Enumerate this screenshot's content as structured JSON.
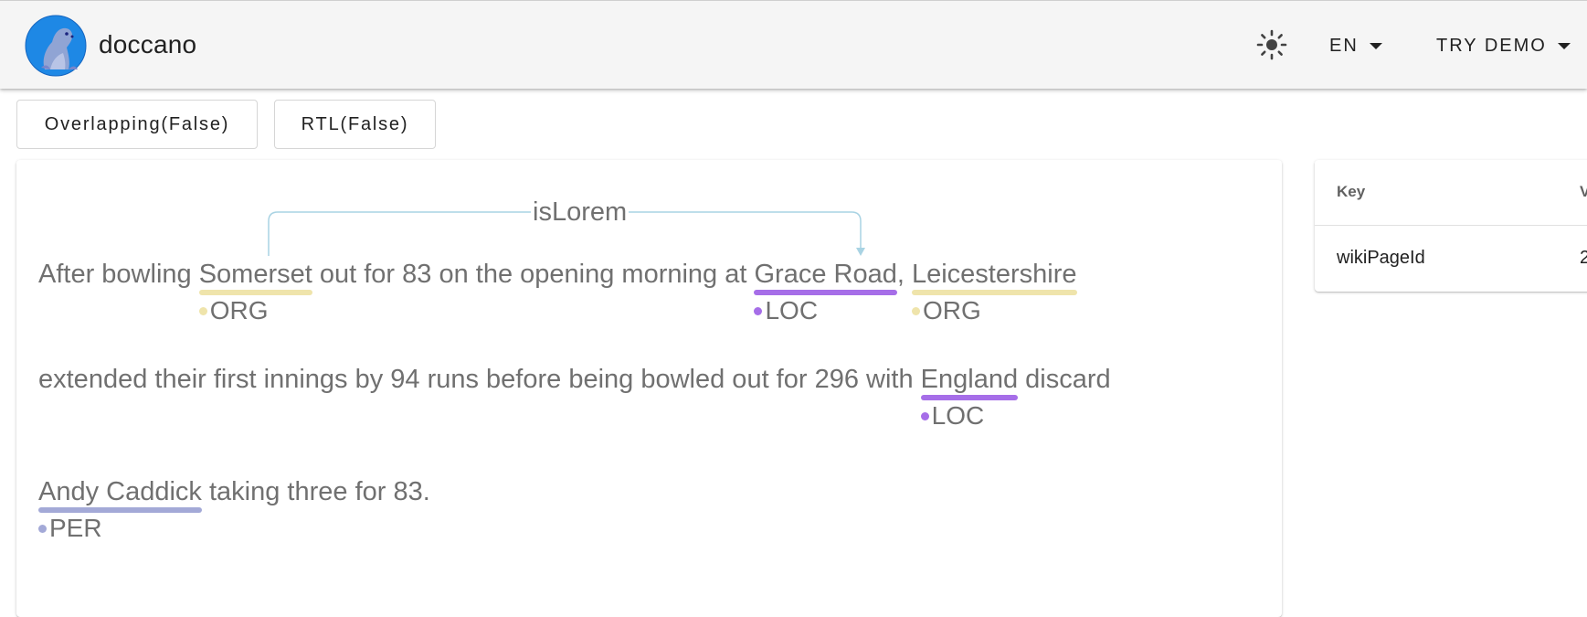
{
  "app": {
    "title": "doccano"
  },
  "header": {
    "theme_icon": "brightness-icon",
    "lang_label": "EN",
    "demo_label": "TRY DEMO"
  },
  "options": {
    "overlapping_label": "Overlapping(False)",
    "rtl_label": "RTL(False)"
  },
  "label_colors": {
    "ORG": "#efe4ab",
    "LOC": "#a66ee8",
    "PER": "#a3a9d7"
  },
  "annotation": {
    "relation": {
      "label": "isLorem",
      "color": "#a9d3e3"
    },
    "line1": {
      "t1": "After bowling ",
      "e1": {
        "text": "Somerset",
        "label": "ORG"
      },
      "t2": " out for 83 on the opening morning at ",
      "e2": {
        "text": "Grace Road",
        "label": "LOC"
      },
      "t3": ", ",
      "e3": {
        "text": "Leicestershire",
        "label": "ORG"
      }
    },
    "line2": {
      "t1": "extended their first innings by 94 runs before being bowled out for 296 with ",
      "e1": {
        "text": "England",
        "label": "LOC"
      },
      "t2": " discard"
    },
    "line3": {
      "e1": {
        "text": "Andy Caddick",
        "label": "PER"
      },
      "t1": " taking three for 83."
    }
  },
  "metadata": {
    "headers": {
      "key": "Key",
      "value": "V"
    },
    "rows": [
      {
        "key": "wikiPageId",
        "value": "2"
      }
    ]
  }
}
